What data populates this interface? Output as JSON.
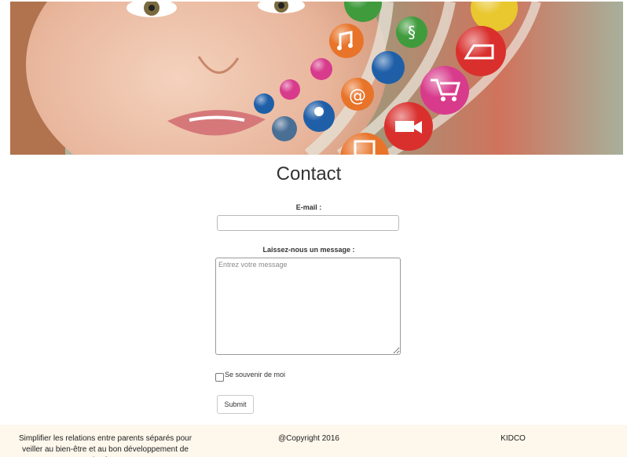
{
  "page": {
    "title": "Contact"
  },
  "form": {
    "email_label": "E-mail :",
    "email_value": "",
    "message_label": "Laissez-nous un message :",
    "message_placeholder": "Entrez votre message",
    "remember_label": "Se souvenir de moi",
    "remember_checked": false,
    "submit_label": "Submit"
  },
  "footer": {
    "tagline": "Simplifier les relations entre parents séparés pour veiller au bien-être et au bon développement de l'enfant",
    "copyright": "@Copyright 2016",
    "brand": "KIDCO",
    "background": "#fdf7ec"
  },
  "hero": {
    "icons": [
      "phone-icon",
      "music-icon",
      "section-icon",
      "tablet-icon",
      "book-icon",
      "podcast-icon",
      "at-icon",
      "shopping-cart-icon",
      "car-icon",
      "user-icon",
      "lightbulb-icon",
      "video-camera-icon",
      "robot-icon",
      "people-icon"
    ],
    "accent_colors": [
      "#e8742a",
      "#3f9b3c",
      "#d9302e",
      "#1f5fa8",
      "#d83b8c",
      "#e9c72e"
    ]
  }
}
